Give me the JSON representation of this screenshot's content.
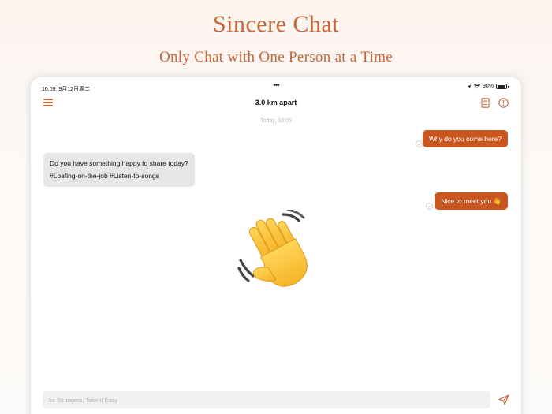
{
  "promo": {
    "title": "Sincere Chat",
    "subtitle": "Only Chat with One Person at a Time"
  },
  "status_bar": {
    "time": "10:09",
    "date": "9月12日周二",
    "dots": "•••",
    "battery": "90%"
  },
  "nav": {
    "title": "3.0 km apart",
    "menu_icon": "hamburger-menu-icon",
    "doc_icon": "document-icon",
    "info_icon": "exclamation-circle-icon"
  },
  "chat": {
    "timestamp": "Today, 10:05",
    "messages": [
      {
        "direction": "outgoing",
        "text": "Why do you come here?"
      },
      {
        "direction": "incoming",
        "text": "Do you have something happy to share today?",
        "tags": "#Loafing-on-the-job #Listen-to-songs"
      },
      {
        "direction": "outgoing",
        "text": "Nice to meet you 👋"
      }
    ],
    "big_emoji": "waving-hand"
  },
  "composer": {
    "placeholder": "As Strangers, Take It Easy",
    "send_icon": "paper-plane-icon"
  },
  "colors": {
    "accent": "#c8663a",
    "bubble_out": "#c8561f",
    "bubble_in": "#e7e7e9"
  }
}
